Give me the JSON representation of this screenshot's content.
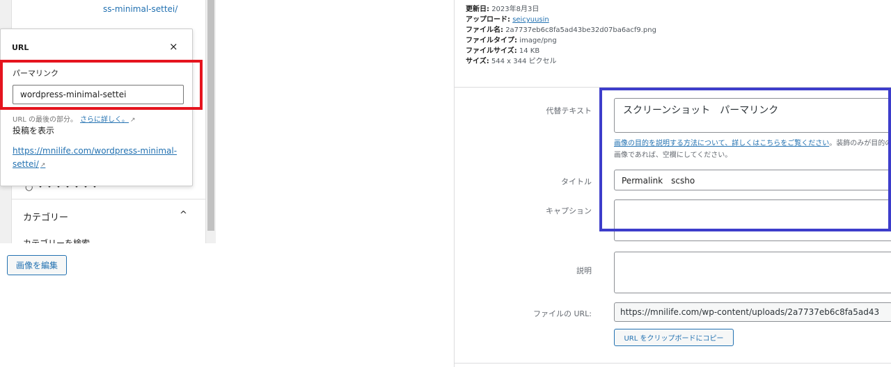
{
  "colors": {
    "accent": "#2271b1",
    "red_highlight": "#e5141e",
    "blue_highlight": "#3d3dcb"
  },
  "sidebar": {
    "top_link": "ss-minimal-settei/",
    "hidden_panel_label": "○ ・・・・・・・",
    "category": {
      "title": "カテゴリー",
      "chevron": "^",
      "item": "カテゴリーを検索"
    }
  },
  "url_popover": {
    "title": "URL",
    "close": "×",
    "permalink_label": "パーマリンク",
    "permalink_value": "wordpress-minimal-settei",
    "help_text": "URL の最後の部分。",
    "help_link": "さらに詳しく。",
    "external_icon": "↗",
    "view_post_label": "投稿を表示",
    "permalink_url": "https://mnilife.com/wordpress-minimal-settei/"
  },
  "edit_image_button": "画像を編集",
  "file_info": {
    "updated_label": "更新日:",
    "updated_value": "2023年8月3日",
    "uploaded_by_label": "アップロード:",
    "uploaded_by_value": "seicyuusin",
    "filename_label": "ファイル名:",
    "filename_value": "2a7737eb6c8fa5ad43be32d07ba6acf9.png",
    "filetype_label": "ファイルタイプ:",
    "filetype_value": "image/png",
    "filesize_label": "ファイルサイズ:",
    "filesize_value": "14 KB",
    "dimensions_label": "サイズ:",
    "dimensions_value": "544 x 344 ピクセル"
  },
  "fields": {
    "alt_label": "代替テキスト",
    "alt_value": "スクリーンショット　パーマリンク",
    "alt_help_link": "画像の目的を説明する方法について、詳しくはこちらをご覧ください",
    "alt_help_text": "。装飾のみが目的の画像であれば、空欄にしてください。",
    "title_label": "タイトル",
    "title_value": "Permalink　scsho",
    "caption_label": "キャプション",
    "caption_value": "",
    "description_label": "説明",
    "description_value": "",
    "file_url_label": "ファイルの URL:",
    "file_url_value": "https://mnilife.com/wp-content/uploads/2a7737eb6c8fa5ad43",
    "copy_url_button": "URL をクリップボードにコピー"
  }
}
